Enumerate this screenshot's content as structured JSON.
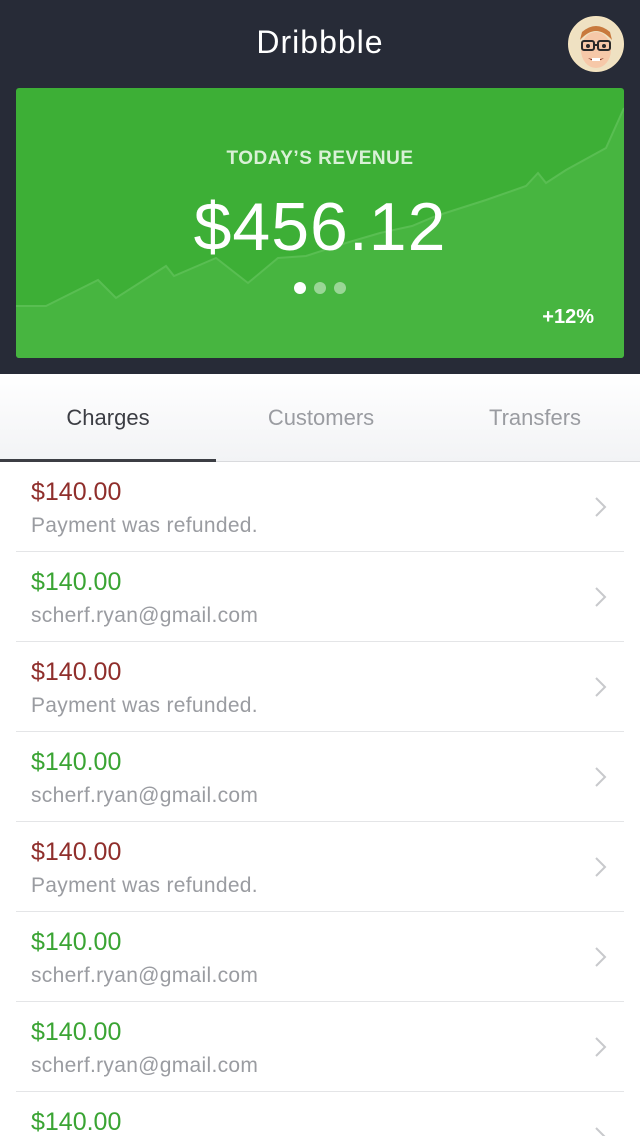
{
  "header": {
    "title": "Dribbble",
    "avatar": "profile-avatar"
  },
  "revenue": {
    "label": "TODAY’S REVENUE",
    "amount": "$456.12",
    "change": "+12%",
    "pages": 3,
    "active_page": 1
  },
  "tabs": [
    {
      "label": "Charges",
      "active": true
    },
    {
      "label": "Customers",
      "active": false
    },
    {
      "label": "Transfers",
      "active": false
    }
  ],
  "charges": [
    {
      "amount": "$140.00",
      "detail": "Payment was refunded.",
      "status": "refunded"
    },
    {
      "amount": "$140.00",
      "detail": "scherf.ryan@gmail.com",
      "status": "paid"
    },
    {
      "amount": "$140.00",
      "detail": "Payment was refunded.",
      "status": "refunded"
    },
    {
      "amount": "$140.00",
      "detail": "scherf.ryan@gmail.com",
      "status": "paid"
    },
    {
      "amount": "$140.00",
      "detail": "Payment was refunded.",
      "status": "refunded"
    },
    {
      "amount": "$140.00",
      "detail": "scherf.ryan@gmail.com",
      "status": "paid"
    },
    {
      "amount": "$140.00",
      "detail": "scherf.ryan@gmail.com",
      "status": "paid"
    },
    {
      "amount": "$140.00",
      "detail": "",
      "status": "paid"
    }
  ],
  "colors": {
    "header_bg": "#272b37",
    "card_bg": "#3daf36",
    "refund": "#8f2e2b",
    "paid": "#3aa433"
  }
}
